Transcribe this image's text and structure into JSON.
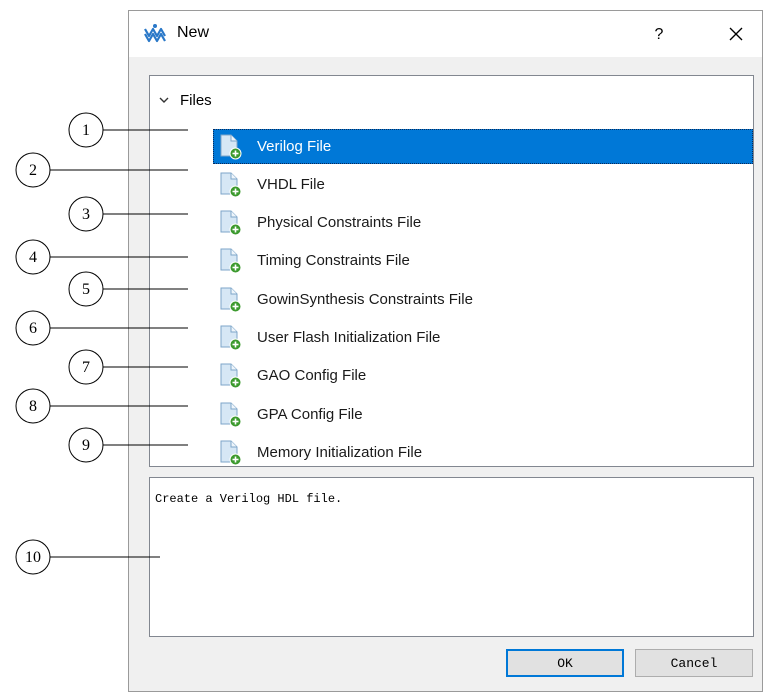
{
  "window": {
    "title": "New",
    "help_label": "?",
    "icon": "gowin-logo-icon",
    "close_icon": "close-icon"
  },
  "tree": {
    "group_label": "Files",
    "group_icon": "chevron-down-icon",
    "items": [
      {
        "label": "Verilog File",
        "selected": true
      },
      {
        "label": "VHDL File",
        "selected": false
      },
      {
        "label": "Physical Constraints File",
        "selected": false
      },
      {
        "label": "Timing Constraints File",
        "selected": false
      },
      {
        "label": "GowinSynthesis Constraints File",
        "selected": false
      },
      {
        "label": "User Flash Initialization File",
        "selected": false
      },
      {
        "label": "GAO Config File",
        "selected": false
      },
      {
        "label": "GPA Config File",
        "selected": false
      },
      {
        "label": "Memory Initialization File",
        "selected": false
      }
    ],
    "item_icon": "new-file-icon"
  },
  "description": {
    "text": "Create a Verilog HDL file."
  },
  "buttons": {
    "ok_label": "OK",
    "cancel_label": "Cancel"
  },
  "callouts": [
    "1",
    "2",
    "3",
    "4",
    "5",
    "6",
    "7",
    "8",
    "9",
    "10"
  ],
  "colors": {
    "selection": "#0078d7",
    "logo": "#2a78c8",
    "icon_plus": "#3c9a2e"
  }
}
